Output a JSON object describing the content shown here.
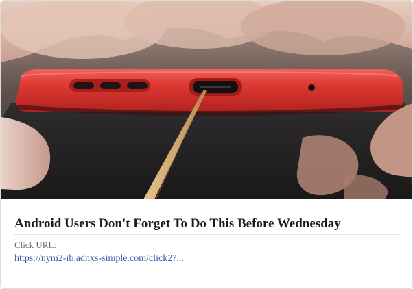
{
  "ad": {
    "image_alt": "Bottom edge of a red Android phone with a toothpick pointing at the USB-C charging port",
    "headline": "Android Users Don't Forget To Do This Before Wednesday",
    "click_label": "Click URL:",
    "click_url": "https://nym2-ib.adnxs-simple.com/click2?..."
  },
  "colors": {
    "link": "#3a5ea8",
    "phone_red": "#d8302f",
    "toothpick": "#d8b27a"
  }
}
